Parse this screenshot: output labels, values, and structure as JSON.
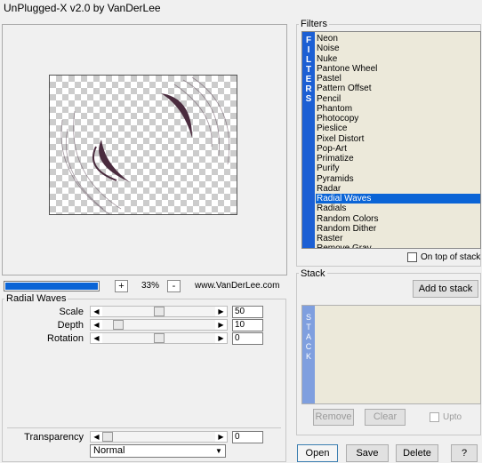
{
  "window": {
    "title": "UnPlugged-X v2.0 by VanDerLee"
  },
  "preview": {
    "zoom_in_label": "+",
    "zoom_value": "33%",
    "zoom_out_label": "-",
    "website": "www.VanDerLee.com",
    "progress_fraction": 1.0
  },
  "params": {
    "group_label": "Radial Waves",
    "sliders": [
      {
        "label": "Scale",
        "value": "50",
        "level": 0.5
      },
      {
        "label": "Depth",
        "value": "10",
        "level": 0.1
      },
      {
        "label": "Rotation",
        "value": "0",
        "level": 0.5
      }
    ],
    "transparency": {
      "label": "Transparency",
      "value": "0",
      "level": 0.0
    },
    "blend_mode": "Normal"
  },
  "filters": {
    "group_label": "Filters",
    "strip_letters": [
      "F",
      "I",
      "L",
      "T",
      "E",
      "R",
      "S"
    ],
    "items": [
      "Neon",
      "Noise",
      "Nuke",
      "Pantone Wheel",
      "Pastel",
      "Pattern Offset",
      "Pencil",
      "Phantom",
      "Photocopy",
      "Pieslice",
      "Pixel Distort",
      "Pop-Art",
      "Primatize",
      "Purify",
      "Pyramids",
      "Radar",
      "Radial Waves",
      "Radials",
      "Random Colors",
      "Random Dither",
      "Raster",
      "Remove Gray"
    ],
    "selected": "Radial Waves",
    "on_top_label": "On top of stack"
  },
  "stack": {
    "group_label": "Stack",
    "add_label": "Add to stack",
    "strip_letters": [
      "S",
      "T",
      "A",
      "C",
      "K"
    ],
    "remove_label": "Remove",
    "clear_label": "Clear",
    "upto_label": "Upto"
  },
  "buttons": {
    "open": "Open",
    "save": "Save",
    "delete": "Delete",
    "help": "?"
  },
  "colors": {
    "selection": "#0a64d6",
    "strip": "#1c5fd4",
    "list_bg": "#ece9da"
  }
}
